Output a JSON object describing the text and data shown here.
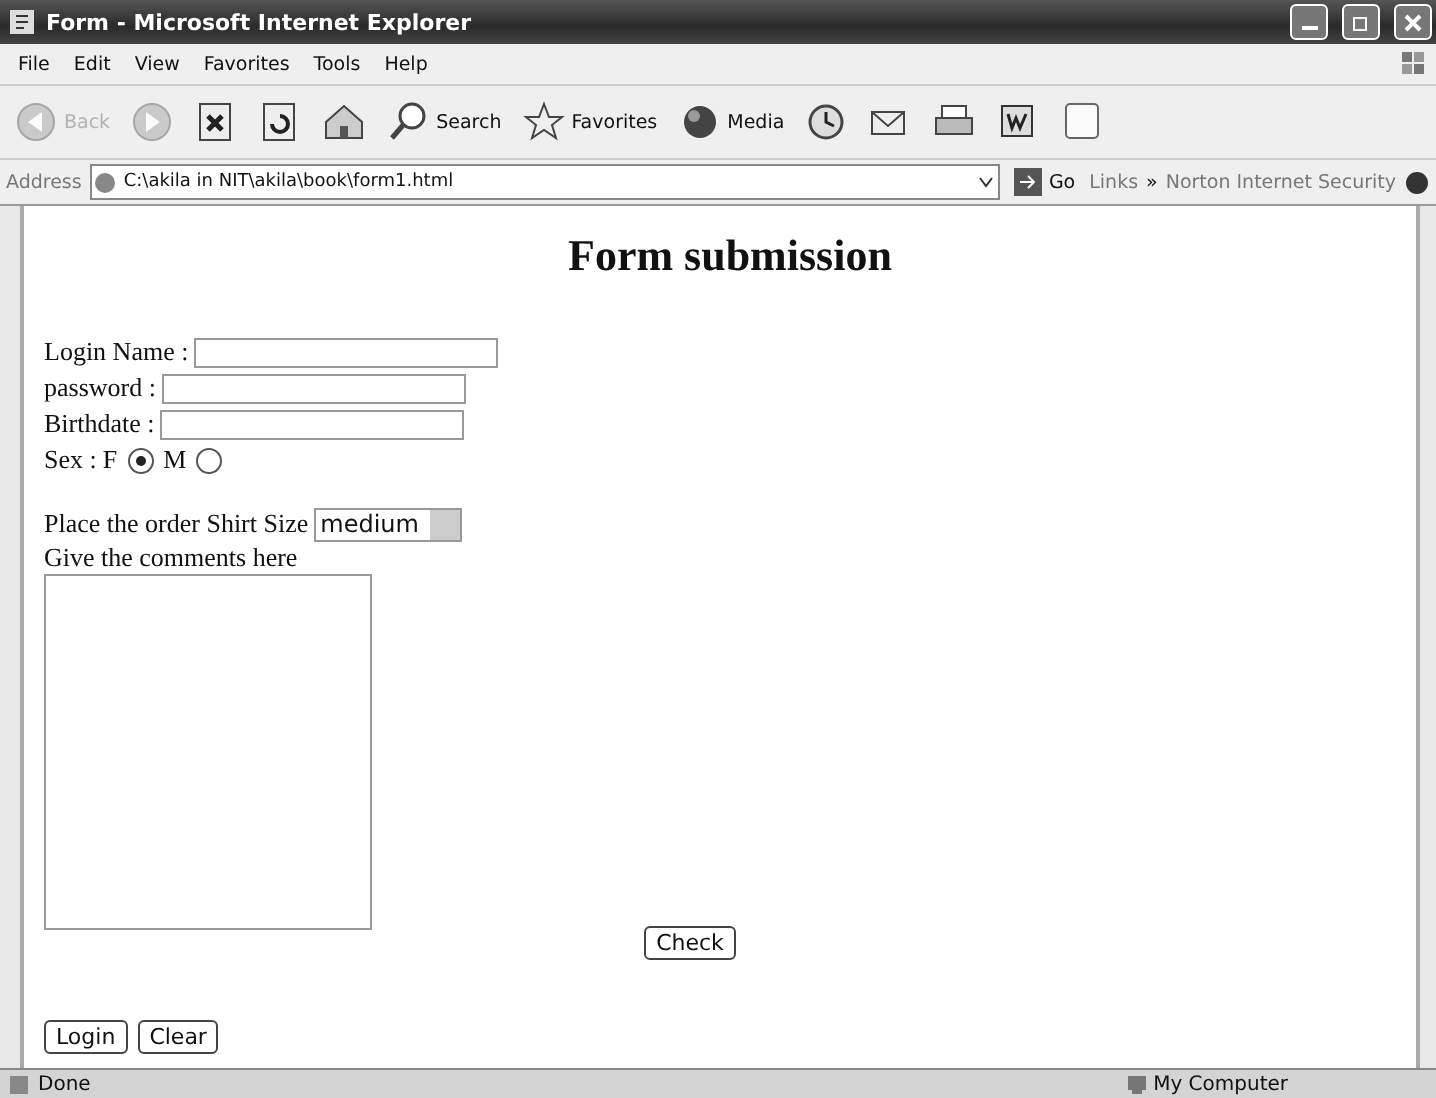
{
  "window": {
    "title": "Form - Microsoft Internet Explorer"
  },
  "menu": [
    "File",
    "Edit",
    "View",
    "Favorites",
    "Tools",
    "Help"
  ],
  "toolbar": [
    {
      "kind": "back",
      "label": "Back",
      "disabled": true
    },
    {
      "kind": "forward",
      "disabled": true
    },
    {
      "kind": "stop",
      "disabled": false
    },
    {
      "kind": "refresh",
      "disabled": false
    },
    {
      "kind": "home",
      "disabled": false
    },
    {
      "kind": "search",
      "label": "Search",
      "disabled": false
    },
    {
      "kind": "favorites",
      "label": "Favorites",
      "disabled": false
    },
    {
      "kind": "media",
      "label": "Media",
      "disabled": false
    },
    {
      "kind": "history",
      "disabled": false
    },
    {
      "kind": "mail",
      "disabled": false
    },
    {
      "kind": "print",
      "disabled": false
    },
    {
      "kind": "edit",
      "disabled": false
    },
    {
      "kind": "discuss",
      "disabled": false
    }
  ],
  "address": {
    "label": "Address",
    "value": "C:\\akila in NIT\\akila\\book\\form1.html",
    "go": "Go",
    "links": "Links",
    "chevron": "»",
    "extra": "Norton Internet Security"
  },
  "form": {
    "heading": "Form submission",
    "fields": [
      {
        "label": "Login Name :"
      },
      {
        "label": "password :"
      },
      {
        "label": "Birthdate :"
      }
    ],
    "sex": {
      "label": "Sex :",
      "options": [
        {
          "label": "F",
          "selected": true
        },
        {
          "label": "M",
          "selected": false
        }
      ]
    },
    "shirt": {
      "label": "Place the order Shirt Size",
      "value": "medium"
    },
    "comments_label": "Give the comments here",
    "check": "Check",
    "login": "Login",
    "clear": "Clear"
  },
  "status_bar": {
    "text": "Done",
    "zone": "My Computer"
  }
}
